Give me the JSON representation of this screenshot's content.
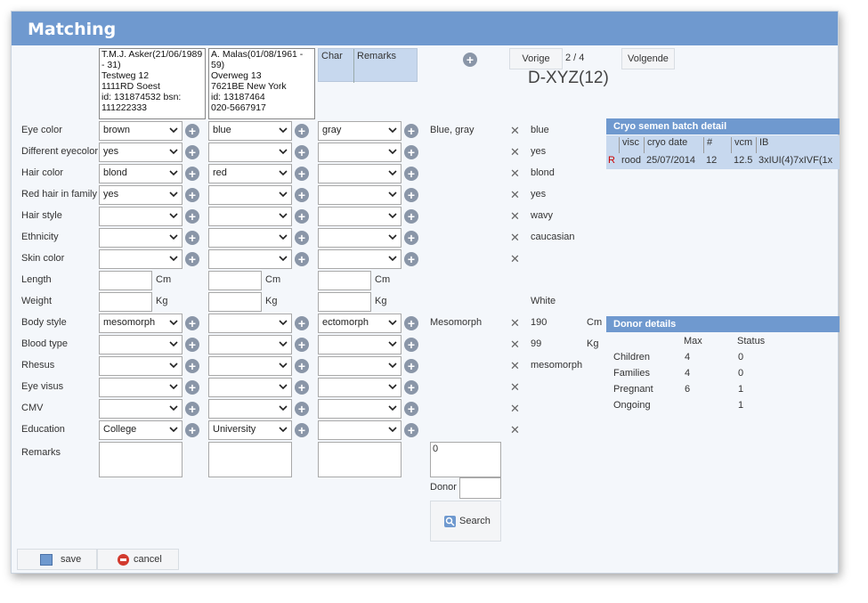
{
  "window": {
    "title": "Matching"
  },
  "persons": [
    {
      "text": "T.M.J. Asker(21/06/1989 - 31)\nTestweg 12\n1111RD Soest\nid: 131874532 bsn: 111222333"
    },
    {
      "text": "A. Malas(01/08/1961 - 59)\nOverweg 13\n7621BE New York\nid: 13187464\n020-5667917"
    }
  ],
  "char_table": {
    "col1": "Char",
    "col2": "Remarks"
  },
  "nav": {
    "prev": "Vorige",
    "counter": "2 / 4",
    "next": "Volgende",
    "code": "D-XYZ(12)"
  },
  "rows": [
    {
      "label": "Eye color",
      "v1": "brown",
      "v2": "blue",
      "v3": "gray",
      "summary": "Blue, gray",
      "donor": "blue"
    },
    {
      "label": "Different eyecolor",
      "v1": "yes",
      "v2": "",
      "v3": "",
      "summary": "",
      "donor": "yes"
    },
    {
      "label": "Hair color",
      "v1": "blond",
      "v2": "red",
      "v3": "",
      "summary": "",
      "donor": "blond"
    },
    {
      "label": "Red hair in family",
      "v1": "yes",
      "v2": "",
      "v3": "",
      "summary": "",
      "donor": "yes"
    },
    {
      "label": "Hair style",
      "v1": "",
      "v2": "",
      "v3": "",
      "summary": "",
      "donor": "wavy"
    },
    {
      "label": "Ethnicity",
      "v1": "",
      "v2": "",
      "v3": "",
      "summary": "",
      "donor": "caucasian"
    },
    {
      "label": "Skin color",
      "v1": "",
      "v2": "",
      "v3": "",
      "summary": "",
      "donor": ""
    }
  ],
  "measures": [
    {
      "label": "Length",
      "unit": "Cm",
      "donor": ""
    },
    {
      "label": "Weight",
      "unit": "Kg",
      "donor": "White"
    }
  ],
  "rows2": [
    {
      "label": "Body style",
      "v1": "mesomorph",
      "v2": "",
      "v3": "ectomorph",
      "summary": "Mesomorph",
      "donor": "190",
      "donor_unit": "Cm"
    },
    {
      "label": "Blood type",
      "v1": "",
      "v2": "",
      "v3": "",
      "summary": "",
      "donor": "99",
      "donor_unit": "Kg"
    },
    {
      "label": "Rhesus",
      "v1": "",
      "v2": "",
      "v3": "",
      "summary": "",
      "donor": "mesomorph",
      "donor_unit": ""
    },
    {
      "label": "Eye visus",
      "v1": "",
      "v2": "",
      "v3": "",
      "summary": "",
      "donor": "",
      "donor_unit": ""
    },
    {
      "label": "CMV",
      "v1": "",
      "v2": "",
      "v3": "",
      "summary": "",
      "donor": "",
      "donor_unit": ""
    },
    {
      "label": "Education",
      "v1": "College",
      "v2": "University",
      "v3": "",
      "summary": "",
      "donor": "",
      "donor_unit": ""
    }
  ],
  "remarks_label": "Remarks",
  "search_area": {
    "count": "0",
    "donor_label": "Donor",
    "search_label": "Search"
  },
  "cryo": {
    "title": "Cryo semen batch detail",
    "headers": [
      "visc",
      "cryo date",
      "#",
      "vcm",
      "IB"
    ],
    "row": {
      "flag": "R",
      "visc": "rood",
      "date": "25/07/2014",
      "count": "12",
      "vcm": "12.5",
      "ib": "3xIUI(4)7xIVF(1x"
    }
  },
  "donor_details": {
    "title": "Donor details",
    "headers": {
      "max": "Max",
      "status": "Status"
    },
    "rows": [
      {
        "label": "Children",
        "max": "4",
        "status": "0"
      },
      {
        "label": "Families",
        "max": "4",
        "status": "0"
      },
      {
        "label": "Pregnant",
        "max": "6",
        "status": "1"
      },
      {
        "label": "Ongoing",
        "max": "",
        "status": "1"
      }
    ]
  },
  "footer": {
    "save": "save",
    "cancel": "cancel"
  },
  "colors": {
    "accent": "#6f99cf",
    "header_cell": "#c7d8ee",
    "flag": "#cc0000"
  }
}
